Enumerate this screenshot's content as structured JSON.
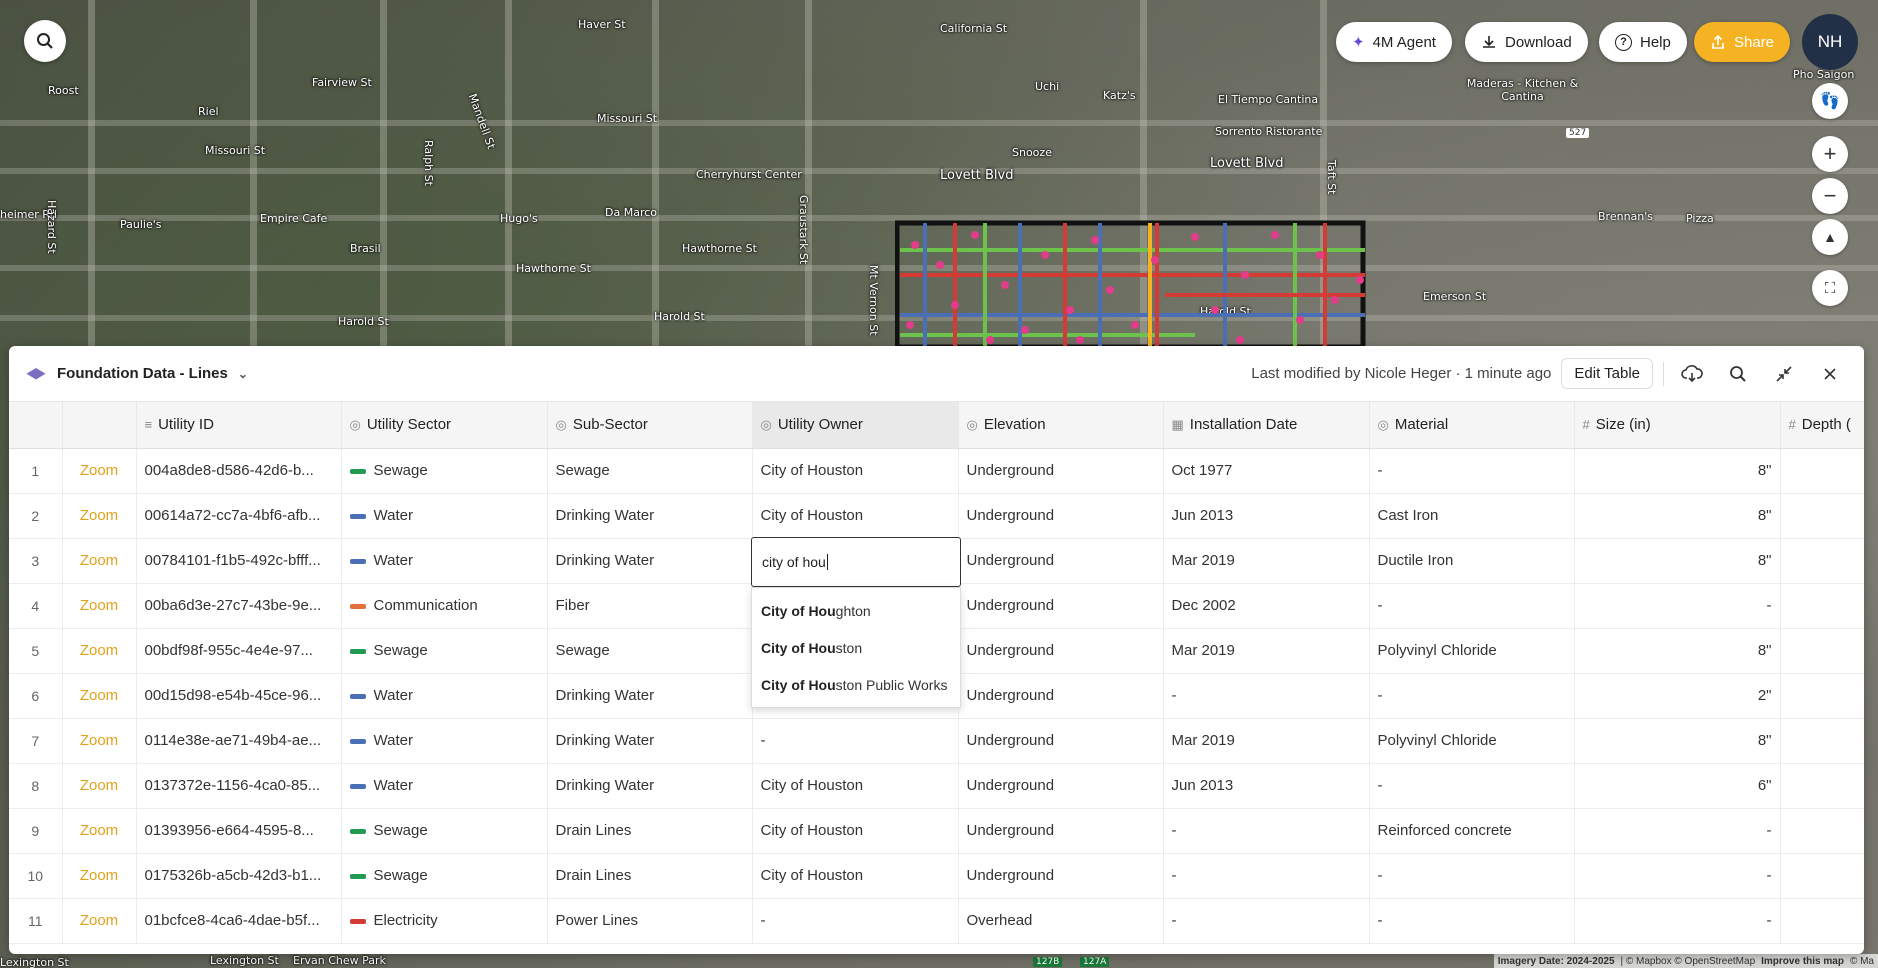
{
  "map": {
    "labels": [
      {
        "text": "Haver St"
      },
      {
        "text": "California St"
      },
      {
        "text": "Roost"
      },
      {
        "text": "Fairview St"
      },
      {
        "text": "Riel"
      },
      {
        "text": "Missouri St"
      },
      {
        "text": "Missouri St"
      },
      {
        "text": "Uchi"
      },
      {
        "text": "Katz's"
      },
      {
        "text": "El Tiempo Cantina"
      },
      {
        "text": "Maderas - Kitchen & Cantina"
      },
      {
        "text": "Pho Saigon"
      },
      {
        "text": "Sorrento Ristorante"
      },
      {
        "text": "Snooze"
      },
      {
        "text": "Lovett Blvd"
      },
      {
        "text": "Lovett Blvd"
      },
      {
        "text": "Cherryhurst Center"
      },
      {
        "text": "heimer Rd"
      },
      {
        "text": "Paulie's"
      },
      {
        "text": "Empire Cafe"
      },
      {
        "text": "Hugo's"
      },
      {
        "text": "Da Marco"
      },
      {
        "text": "Brasil"
      },
      {
        "text": "Hawthorne St"
      },
      {
        "text": "Hawthorne St"
      },
      {
        "text": "Harold St"
      },
      {
        "text": "Harold St"
      },
      {
        "text": "Harold St"
      },
      {
        "text": "Emerson St"
      },
      {
        "text": "Brennan's"
      },
      {
        "text": "Pizza"
      },
      {
        "text": "Hazard St"
      },
      {
        "text": "Ralph St"
      },
      {
        "text": "Mandell St"
      },
      {
        "text": "Graustark St"
      },
      {
        "text": "Mt Vernon St"
      },
      {
        "text": "Taft St"
      },
      {
        "text": "Lexington St"
      },
      {
        "text": "Ervan Chew Park"
      },
      {
        "text": "527"
      },
      {
        "text": "127B"
      },
      {
        "text": "127A"
      }
    ],
    "attribution": {
      "imagery": "Imagery Date: 2024-2025",
      "copyright": "| © Mapbox © OpenStreetMap",
      "improve": "Improve this map",
      "tail": "© Ma"
    }
  },
  "topbar": {
    "agent": "4M Agent",
    "download": "Download",
    "help": "Help",
    "share": "Share",
    "avatar": "NH"
  },
  "panel": {
    "title": "Foundation Data - Lines",
    "last_modified": "Last modified by Nicole Heger · 1 minute ago",
    "edit_table": "Edit Table",
    "columns": [
      "Utility ID",
      "Utility Sector",
      "Sub-Sector",
      "Utility Owner",
      "Elevation",
      "Installation Date",
      "Material",
      "Size (in)",
      "Depth ("
    ],
    "zoom_label": "Zoom",
    "rows": [
      {
        "n": "1",
        "id": "004a8de8-d586-42d6-b...",
        "sector": "Sewage",
        "color": "#1f9a50",
        "sub": "Sewage",
        "owner": "City of Houston",
        "elev": "Underground",
        "date": "Oct 1977",
        "mat": "-",
        "size": "8\""
      },
      {
        "n": "2",
        "id": "00614a72-cc7a-4bf6-afb...",
        "sector": "Water",
        "color": "#4a6fb5",
        "sub": "Drinking Water",
        "owner": "City of Houston",
        "elev": "Underground",
        "date": "Jun 2013",
        "mat": "Cast Iron",
        "size": "8\""
      },
      {
        "n": "3",
        "id": "00784101-f1b5-492c-bfff...",
        "sector": "Water",
        "color": "#4a6fb5",
        "sub": "Drinking Water",
        "owner": "",
        "elev": "Underground",
        "date": "Mar 2019",
        "mat": "Ductile Iron",
        "size": "8\""
      },
      {
        "n": "4",
        "id": "00ba6d3e-27c7-43be-9e...",
        "sector": "Communication",
        "color": "#e2703a",
        "sub": "Fiber",
        "owner": "",
        "elev": "Underground",
        "date": "Dec 2002",
        "mat": "-",
        "size": "-"
      },
      {
        "n": "5",
        "id": "00bdf98f-955c-4e4e-97...",
        "sector": "Sewage",
        "color": "#1f9a50",
        "sub": "Sewage",
        "owner": "",
        "elev": "Underground",
        "date": "Mar 2019",
        "mat": "Polyvinyl Chloride",
        "size": "8\""
      },
      {
        "n": "6",
        "id": "00d15d98-e54b-45ce-96...",
        "sector": "Water",
        "color": "#4a6fb5",
        "sub": "Drinking Water",
        "owner": "",
        "elev": "Underground",
        "date": "-",
        "mat": "-",
        "size": "2\""
      },
      {
        "n": "7",
        "id": "0114e38e-ae71-49b4-ae...",
        "sector": "Water",
        "color": "#4a6fb5",
        "sub": "Drinking Water",
        "owner": "-",
        "elev": "Underground",
        "date": "Mar 2019",
        "mat": "Polyvinyl Chloride",
        "size": "8\""
      },
      {
        "n": "8",
        "id": "0137372e-1156-4ca0-85...",
        "sector": "Water",
        "color": "#4a6fb5",
        "sub": "Drinking Water",
        "owner": "City of Houston",
        "elev": "Underground",
        "date": "Jun 2013",
        "mat": "-",
        "size": "6\""
      },
      {
        "n": "9",
        "id": "01393956-e664-4595-8...",
        "sector": "Sewage",
        "color": "#1f9a50",
        "sub": "Drain Lines",
        "owner": "City of Houston",
        "elev": "Underground",
        "date": "-",
        "mat": "Reinforced concrete",
        "size": "-"
      },
      {
        "n": "10",
        "id": "0175326b-a5cb-42d3-b1...",
        "sector": "Sewage",
        "color": "#1f9a50",
        "sub": "Drain Lines",
        "owner": "City of Houston",
        "elev": "Underground",
        "date": "-",
        "mat": "-",
        "size": "-"
      },
      {
        "n": "11",
        "id": "01bcfce8-4ca6-4dae-b5f...",
        "sector": "Electricity",
        "color": "#d43b34",
        "sub": "Power Lines",
        "owner": "-",
        "elev": "Overhead",
        "date": "-",
        "mat": "-",
        "size": "-"
      }
    ]
  },
  "editor": {
    "value": "city of hou",
    "options": [
      {
        "match": "City of Hou",
        "rest": "ghton"
      },
      {
        "match": "City of Hou",
        "rest": "ston"
      },
      {
        "match": "City of Hou",
        "rest": "ston Public Works"
      }
    ]
  },
  "colors": {
    "accent": "#f5b324",
    "zoom": "#e0a21b",
    "avatar": "#223047"
  }
}
